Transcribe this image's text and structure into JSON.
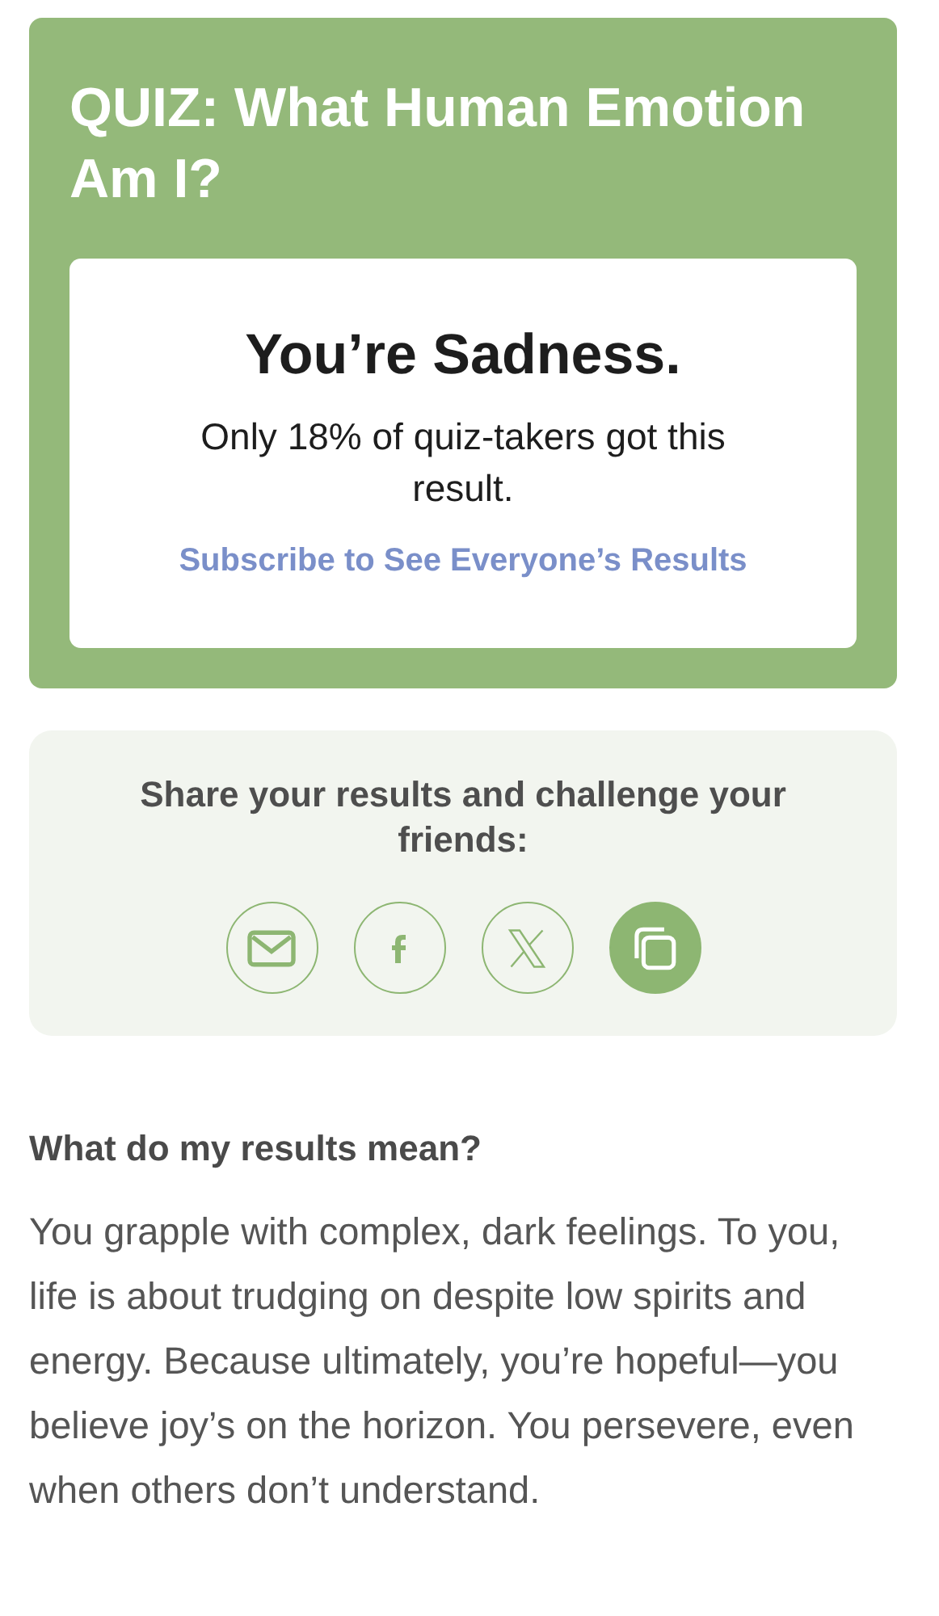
{
  "quiz": {
    "title": "QUIZ: What Human Emotion Am I?",
    "result": "You’re Sadness.",
    "stat": "Only 18% of quiz-takers got this result.",
    "link": "Subscribe to See Everyone’s Results"
  },
  "share": {
    "heading": "Share your results and challenge your friends:",
    "buttons": [
      {
        "kind": "email"
      },
      {
        "kind": "facebook"
      },
      {
        "kind": "x"
      },
      {
        "kind": "copy"
      }
    ]
  },
  "meaning": {
    "heading": "What do my results mean?",
    "text": "You grapple with complex, dark feelings. To you, life is about trudging on despite low spirits and energy. Because ultimately, you’re hopeful—you believe joy’s on the horizon. You persevere, even when others don’t understand."
  }
}
